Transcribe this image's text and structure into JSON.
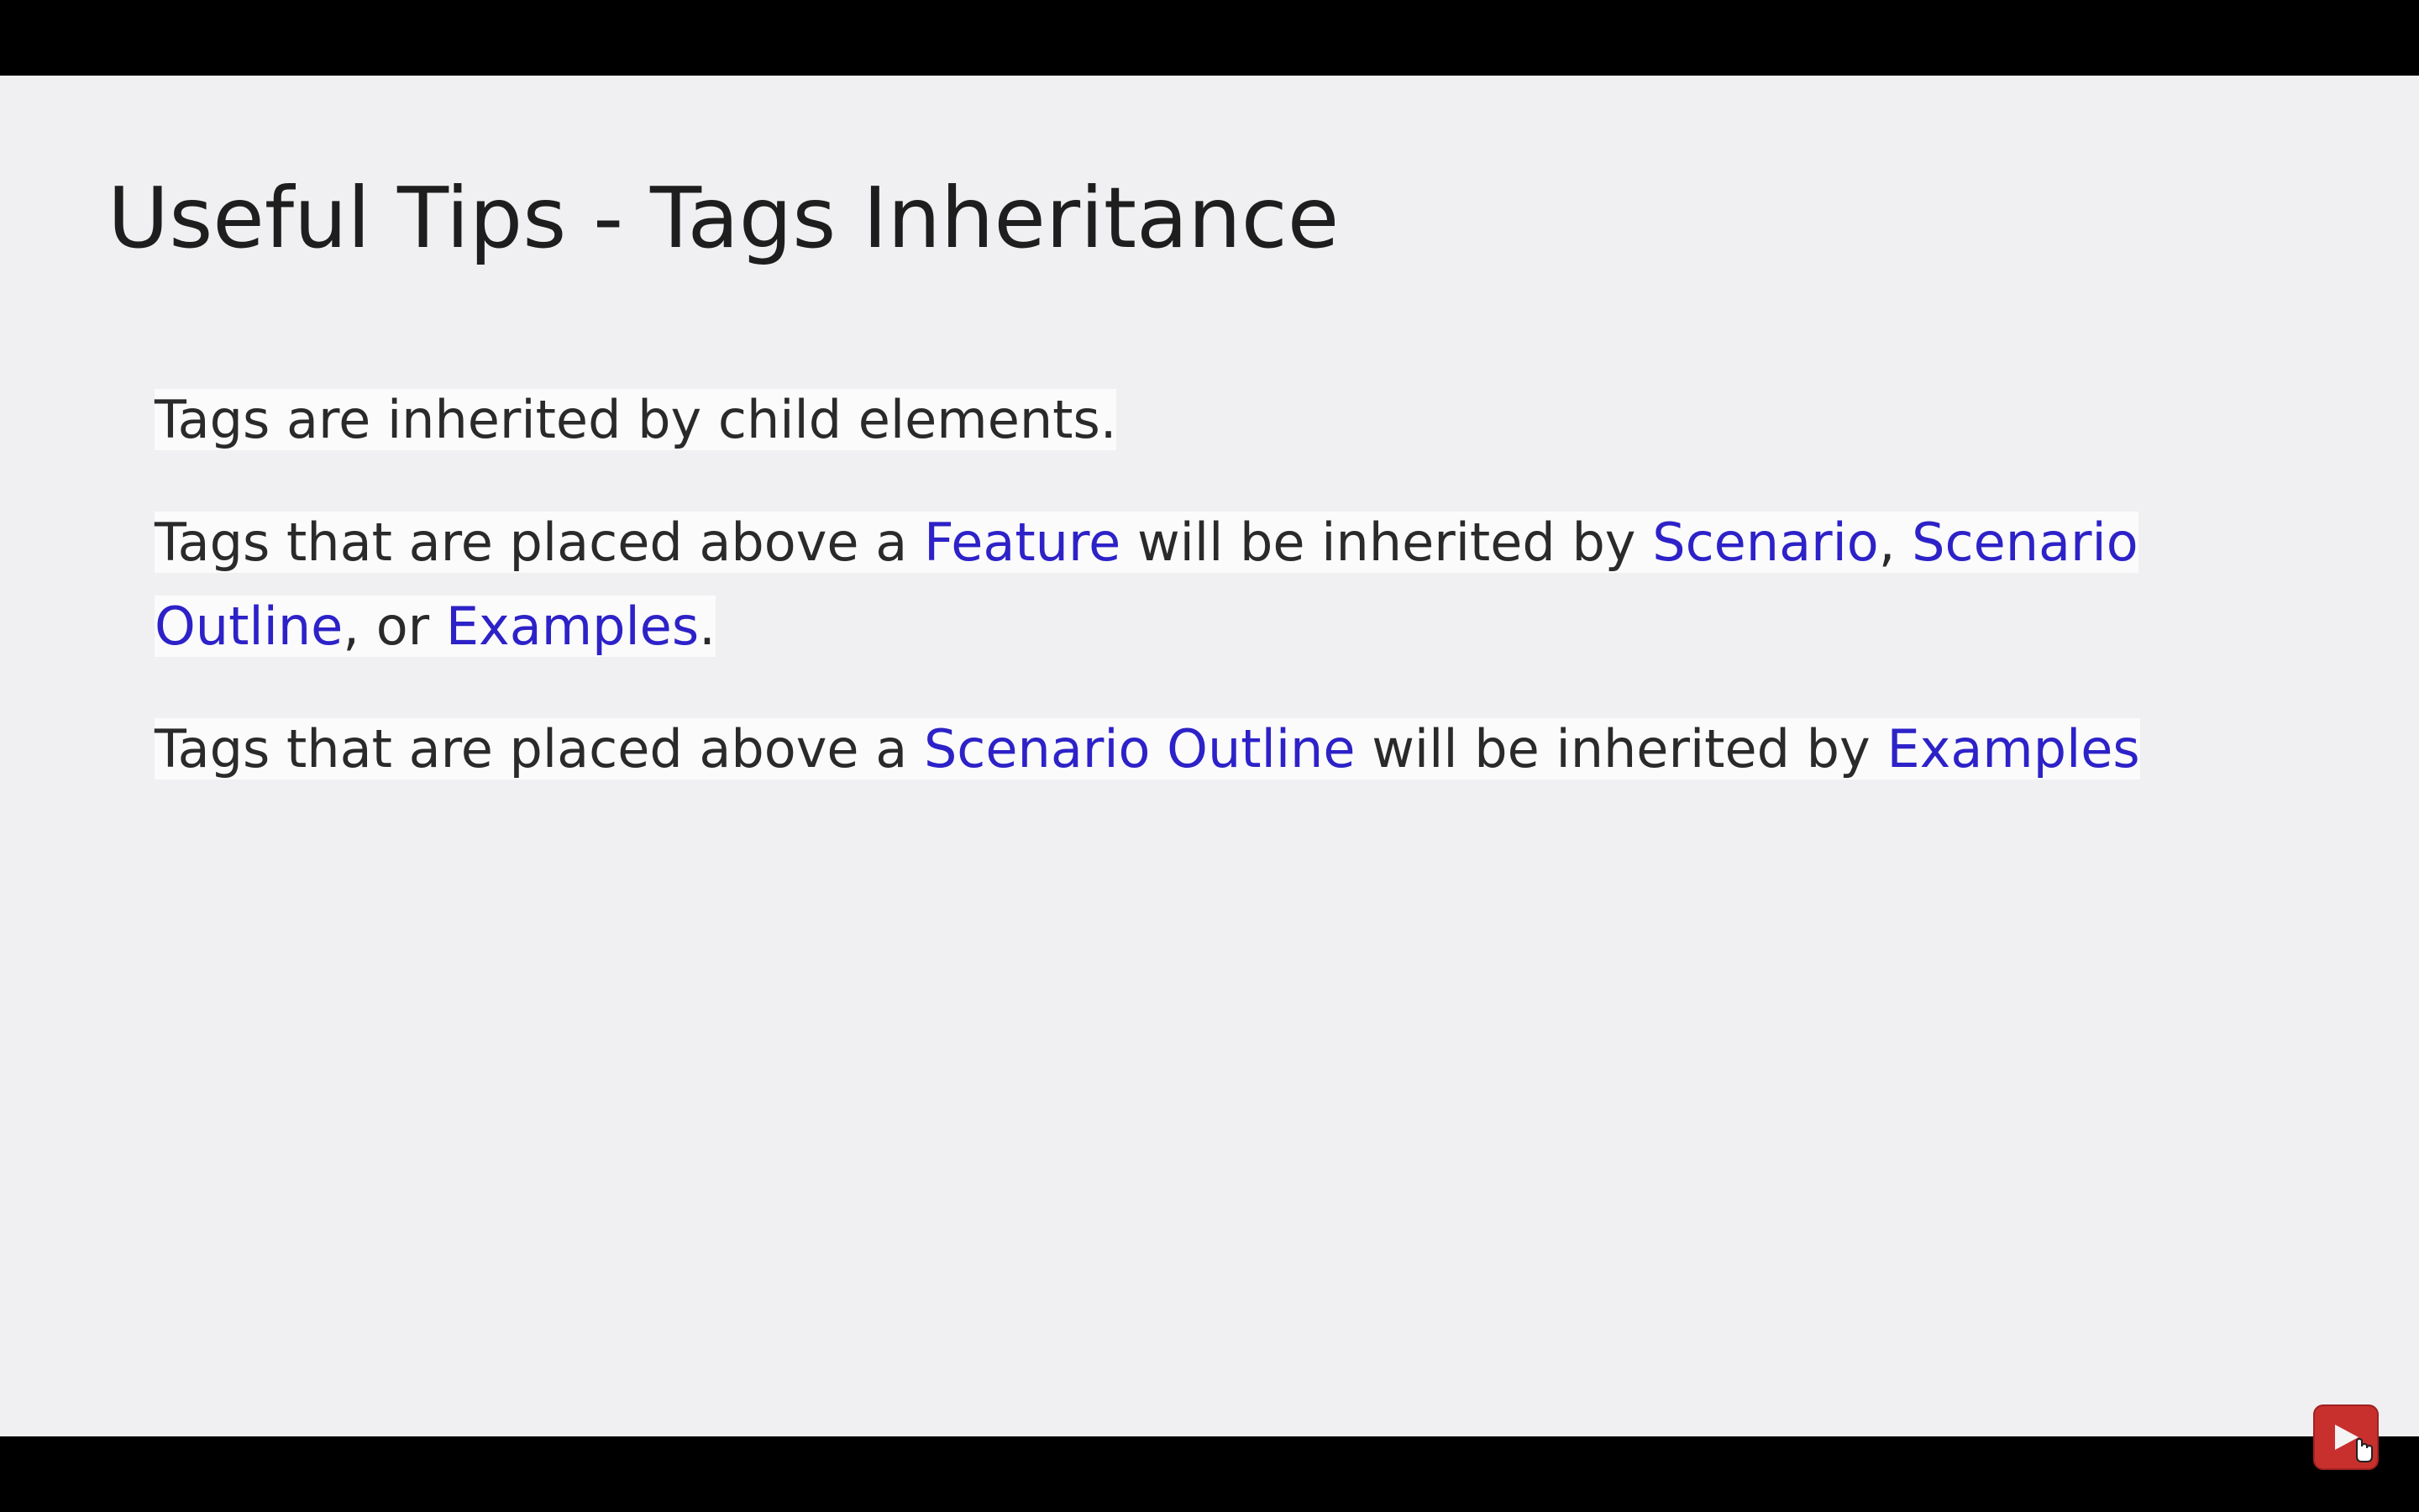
{
  "slide": {
    "title": "Useful Tips - Tags Inheritance",
    "paragraph1": {
      "text": "Tags are inherited by child elements."
    },
    "paragraph2": {
      "part1": "Tags that are placed above a ",
      "kw1": "Feature",
      "part2": " will be inherited by ",
      "kw2": "Scenario",
      "part3": ", ",
      "kw3": "Scenario Outline",
      "part4": ", or ",
      "kw4": "Examples",
      "part5": "."
    },
    "paragraph3": {
      "part1": "Tags that are placed above a ",
      "kw1": "Scenario Outline",
      "part2": " will be inherited by ",
      "kw2": "Examples"
    }
  },
  "overlay": {
    "play_icon": "play-icon",
    "cursor_icon": "hand-cursor-icon",
    "accent_color": "#c8302e",
    "keyword_color": "#2d22c8"
  }
}
